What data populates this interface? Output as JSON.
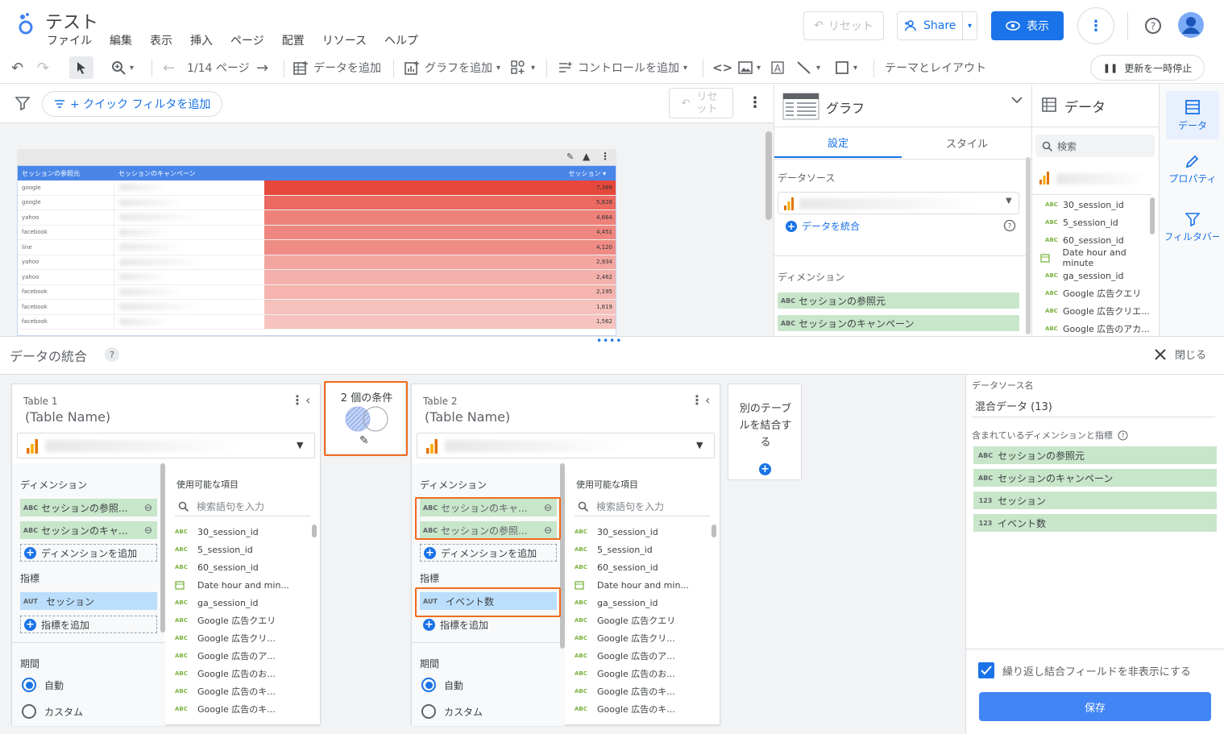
{
  "header": {
    "title": "テスト",
    "menu": [
      "ファイル",
      "編集",
      "表示",
      "挿入",
      "ページ",
      "配置",
      "リソース",
      "ヘルプ"
    ],
    "reset_label": "リセット",
    "share_label": "Share",
    "view_label": "表示"
  },
  "toolbar": {
    "page_indicator": "1/14 ページ",
    "add_data": "データを追加",
    "add_chart": "グラフを追加",
    "add_control": "コントロールを追加",
    "theme_layout": "テーマとレイアウト",
    "pause_update": "更新を一時停止"
  },
  "filterbar": {
    "quick_filter": "+ クイック フィルタを追加",
    "reset": "リセ ット"
  },
  "report_table": {
    "col1": "セッションの参照元",
    "col2": "セッションのキャンペーン",
    "col3": "セッション",
    "sort_indicator": "▾",
    "rows": [
      {
        "source": "google",
        "value": "7,389",
        "intensity": 1.0
      },
      {
        "source": "google",
        "value": "5,828",
        "intensity": 0.79
      },
      {
        "source": "yahoo",
        "value": "4,664",
        "intensity": 0.63
      },
      {
        "source": "facebook",
        "value": "4,451",
        "intensity": 0.6
      },
      {
        "source": "line",
        "value": "4,120",
        "intensity": 0.56
      },
      {
        "source": "yahoo",
        "value": "2,934",
        "intensity": 0.4
      },
      {
        "source": "yahoo",
        "value": "2,462",
        "intensity": 0.33
      },
      {
        "source": "facebook",
        "value": "2,195",
        "intensity": 0.3
      },
      {
        "source": "facebook",
        "value": "1,619",
        "intensity": 0.22
      },
      {
        "source": "facebook",
        "value": "1,562",
        "intensity": 0.21
      }
    ]
  },
  "graph_panel": {
    "title": "グラフ",
    "tab_setup": "設定",
    "tab_style": "スタイル",
    "datasource_label": "データソース",
    "blend_link": "データを統合",
    "dimension_label": "ディメンション",
    "dimensions": [
      "セッションの参照元",
      "セッションのキャンペーン"
    ]
  },
  "data_panel": {
    "title": "データ",
    "search_placeholder": "検索",
    "fields": [
      {
        "type": "ABC",
        "name": "30_session_id"
      },
      {
        "type": "ABC",
        "name": "5_session_id"
      },
      {
        "type": "ABC",
        "name": "60_session_id"
      },
      {
        "type": "DATE",
        "name": "Date hour and minute"
      },
      {
        "type": "ABC",
        "name": "ga_session_id"
      },
      {
        "type": "ABC",
        "name": "Google 広告クエリ"
      },
      {
        "type": "ABC",
        "name": "Google 広告クリエ..."
      },
      {
        "type": "ABC",
        "name": "Google 広告のアカ..."
      }
    ]
  },
  "rail": {
    "data": "データ",
    "properties": "プロパティ",
    "filter": "フィルタバー"
  },
  "blend": {
    "title": "データの統合",
    "help": "?",
    "close": "閉じる",
    "join_condition": "2 個の条件",
    "add_table": "別のテーブルを結合する",
    "table1": {
      "title": "Table 1",
      "subtitle": "(Table Name)",
      "dimension_label": "ディメンション",
      "dimensions": [
        "セッションの参照...",
        "セッションのキャ..."
      ],
      "add_dimension": "ディメンションを追加",
      "metric_label": "指標",
      "metrics": [
        {
          "type": "AUT",
          "name": "セッション"
        }
      ],
      "add_metric": "指標を追加",
      "period_label": "期間",
      "period_auto": "自動",
      "period_custom": "カスタム",
      "available_label": "使用可能な項目",
      "search_placeholder": "検索語句を入力",
      "available": [
        "30_session_id",
        "5_session_id",
        "60_session_id",
        "Date hour and min...",
        "ga_session_id",
        "Google 広告クエリ",
        "Google 広告クリ...",
        "Google 広告のア...",
        "Google 広告のお...",
        "Google 広告のキ...",
        "Google 広告のキ..."
      ]
    },
    "table2": {
      "title": "Table 2",
      "subtitle": "(Table Name)",
      "dimension_label": "ディメンション",
      "dimensions": [
        "セッションのキャ...",
        "セッションの参照..."
      ],
      "add_dimension": "ディメンションを追加",
      "metric_label": "指標",
      "metrics": [
        {
          "type": "AUT",
          "name": "イベント数"
        }
      ],
      "add_metric": "指標を追加",
      "period_label": "期間",
      "period_auto": "自動",
      "period_custom": "カスタム",
      "available_label": "使用可能な項目",
      "search_placeholder": "検索語句を入力",
      "available": [
        "30_session_id",
        "5_session_id",
        "60_session_id",
        "Date hour and min...",
        "ga_session_id",
        "Google 広告クエリ",
        "Google 広告クリ...",
        "Google 広告のア...",
        "Google 広告のお...",
        "Google 広告のキ...",
        "Google 広告のキ..."
      ]
    },
    "right": {
      "source_name_label": "データソース名",
      "source_name": "混合データ (13)",
      "included_label": "含まれているディメンションと指標",
      "included": [
        {
          "type": "ABC",
          "name": "セッションの参照元"
        },
        {
          "type": "ABC",
          "name": "セッションのキャンペーン"
        },
        {
          "type": "123",
          "name": "セッション"
        },
        {
          "type": "123",
          "name": "イベント数"
        }
      ],
      "hide_repeat_label": "繰り返し結合フィールドを非表示にする",
      "save_label": "保存"
    }
  },
  "colors": {
    "accent": "#1a73e8",
    "highlight": "#f26b1d",
    "dim_chip": "#c8e6c9",
    "metric_chip": "#bbdefb",
    "heat": "#e6483d"
  }
}
